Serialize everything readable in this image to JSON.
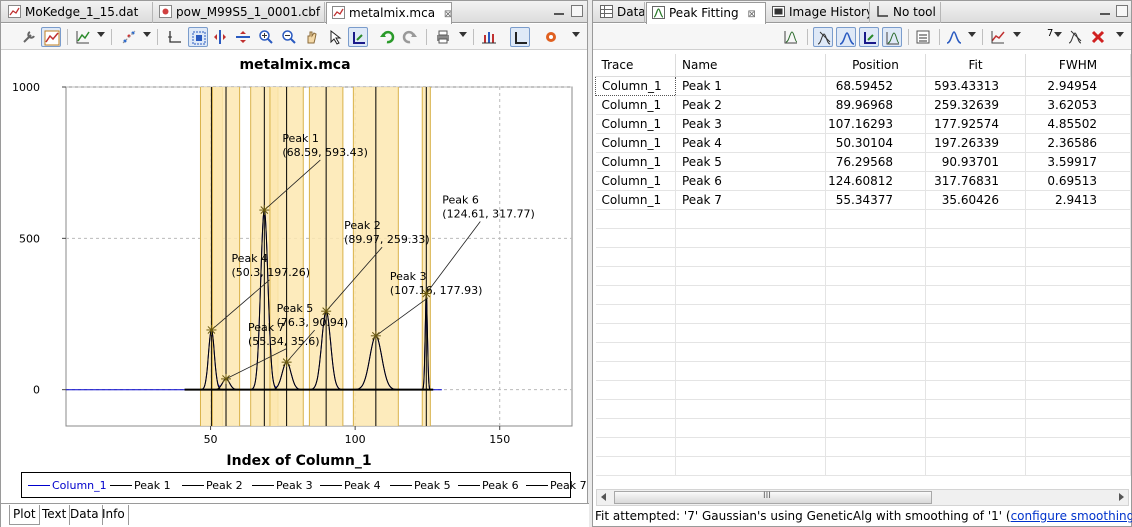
{
  "left": {
    "tabs": [
      {
        "label": "MoKedge_1_15.dat",
        "icon": "line-chart-icon"
      },
      {
        "label": "pow_M99S5_1_0001.cbf",
        "icon": "image-file-icon"
      },
      {
        "label": "metalmix.mca",
        "icon": "line-chart-icon",
        "active": true,
        "close": "⊠"
      }
    ],
    "bottom_tabs": [
      "Plot",
      "Text",
      "Data",
      "Info"
    ]
  },
  "right": {
    "tabs": [
      {
        "label": "Data",
        "icon": "table-icon"
      },
      {
        "label": "Peak Fitting",
        "icon": "peak-fit-icon",
        "active": true,
        "close": "⊠"
      },
      {
        "label": "Image History",
        "icon": "image-history-icon"
      },
      {
        "label": "No tool",
        "icon": "axis-icon"
      }
    ],
    "peak_count": "7",
    "table": {
      "columns": [
        "Trace",
        "Name",
        "Position",
        "Fit",
        "FWHM"
      ],
      "rows": [
        [
          "Column_1",
          "Peak 1",
          "68.59452",
          "593.43313",
          "2.94954"
        ],
        [
          "Column_1",
          "Peak 2",
          "89.96968",
          "259.32639",
          "3.62053"
        ],
        [
          "Column_1",
          "Peak 3",
          "107.16293",
          "177.92574",
          "4.85502"
        ],
        [
          "Column_1",
          "Peak 4",
          "50.30104",
          "197.26339",
          "2.36586"
        ],
        [
          "Column_1",
          "Peak 5",
          "76.29568",
          "90.93701",
          "3.59917"
        ],
        [
          "Column_1",
          "Peak 6",
          "124.60812",
          "317.76831",
          "0.69513"
        ],
        [
          "Column_1",
          "Peak 7",
          "55.34377",
          "35.60426",
          "2.9413"
        ]
      ]
    },
    "scroll_grip": "III",
    "status": {
      "text": "Fit attempted: '7' Gaussian's using GeneticAlg with smoothing of '1' (",
      "link": "configure smoothing",
      "suffix": ")"
    }
  },
  "chart_data": {
    "type": "line",
    "title": "metalmix.mca",
    "xlabel": "Index of Column_1",
    "ylabel": "",
    "xlim": [
      0,
      175
    ],
    "ylim": [
      -120,
      1000
    ],
    "xticks": [
      50,
      100,
      150
    ],
    "yticks": [
      0,
      500,
      1000
    ],
    "grid": true,
    "legend": "bottom",
    "colors": {
      "data": "#0000cc",
      "fit": "#000000",
      "band": "#fde8b0",
      "band_line": "#d9b24a"
    },
    "series": [
      {
        "name": "Column_1",
        "color": "#0000cc"
      },
      {
        "name": "Peak 1"
      },
      {
        "name": "Peak 2"
      },
      {
        "name": "Peak 3"
      },
      {
        "name": "Peak 4"
      },
      {
        "name": "Peak 5"
      },
      {
        "name": "Peak 6"
      },
      {
        "name": "Peak 7"
      }
    ],
    "peaks": [
      {
        "name": "Peak 1",
        "x": 68.59,
        "y": 593.43,
        "fwhm": 2.95,
        "label": "Peak 1",
        "coords": "(68.59, 593.43)"
      },
      {
        "name": "Peak 2",
        "x": 89.97,
        "y": 259.33,
        "fwhm": 3.62,
        "label": "Peak 2",
        "coords": "(89.97, 259.33)"
      },
      {
        "name": "Peak 3",
        "x": 107.16,
        "y": 177.93,
        "fwhm": 4.86,
        "label": "Peak 3",
        "coords": "(107.16, 177.93)"
      },
      {
        "name": "Peak 4",
        "x": 50.3,
        "y": 197.26,
        "fwhm": 2.37,
        "label": "Peak 4",
        "coords": "(50.3, 197.26)"
      },
      {
        "name": "Peak 5",
        "x": 76.3,
        "y": 90.94,
        "fwhm": 3.6,
        "label": "Peak 5",
        "coords": "(76.3, 90.94)"
      },
      {
        "name": "Peak 6",
        "x": 124.61,
        "y": 317.77,
        "fwhm": 0.7,
        "label": "Peak 6",
        "coords": "(124.61, 317.77)"
      },
      {
        "name": "Peak 7",
        "x": 55.34,
        "y": 35.6,
        "fwhm": 2.94,
        "label": "Peak 7",
        "coords": "(55.34, 35.6)"
      }
    ]
  }
}
